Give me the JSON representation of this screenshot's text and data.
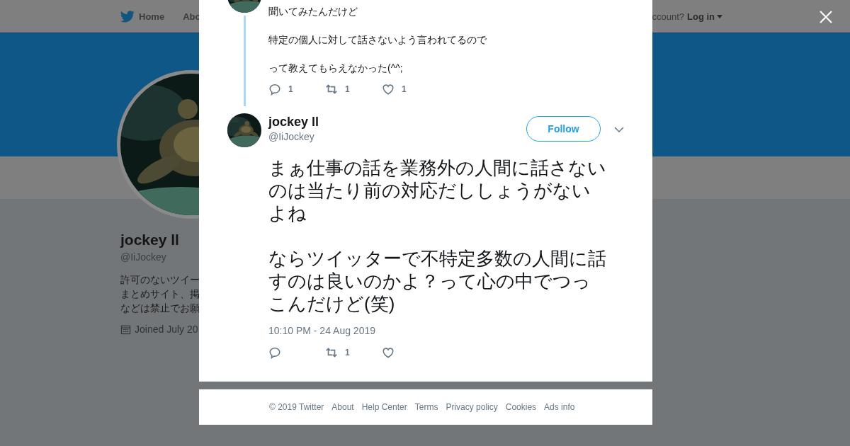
{
  "background_page": {
    "nav": {
      "items": [
        {
          "label": "Home"
        },
        {
          "label": "Abo"
        }
      ],
      "account_prompt": "ccount?",
      "login": "Log in"
    },
    "profile": {
      "name": "jockey ll",
      "handle": "@IiJockey",
      "bio_lines": [
        "許可のないツイー",
        "まとめサイト、掲",
        "などは禁止でお願"
      ],
      "joined": "Joined July 20"
    }
  },
  "modal": {
    "parent_tweet": {
      "paragraphs": [
        [
          "聞いてみたんだけど"
        ],
        [
          "特定の個人に対して話さないよう言われてるので"
        ],
        [
          "って教えてもらえなかった(^^;"
        ]
      ],
      "actions": [
        {
          "kind": "reply",
          "count": "1"
        },
        {
          "kind": "retweet",
          "count": "1"
        },
        {
          "kind": "like",
          "count": "1"
        }
      ]
    },
    "tweet": {
      "name": "jockey ll",
      "handle": "@IiJockey",
      "follow_label": "Follow",
      "paragraphs": [
        [
          "まぁ仕事の話を業務外の人間に話さない",
          "のは当たり前の対応だししょうがない",
          "よね"
        ],
        [
          "ならツイッターで不特定多数の人間に話",
          "すのは良いのかよ？って心の中でつっ",
          "こんだけど(笑)"
        ]
      ],
      "timestamp": "10:10 PM - 24 Aug 2019",
      "actions": [
        {
          "kind": "reply"
        },
        {
          "kind": "retweet",
          "count": "1"
        },
        {
          "kind": "like"
        }
      ]
    }
  },
  "footer": {
    "links": [
      "© 2019 Twitter",
      "About",
      "Help Center",
      "Terms",
      "Privacy policy",
      "Cookies",
      "Ads info"
    ]
  }
}
